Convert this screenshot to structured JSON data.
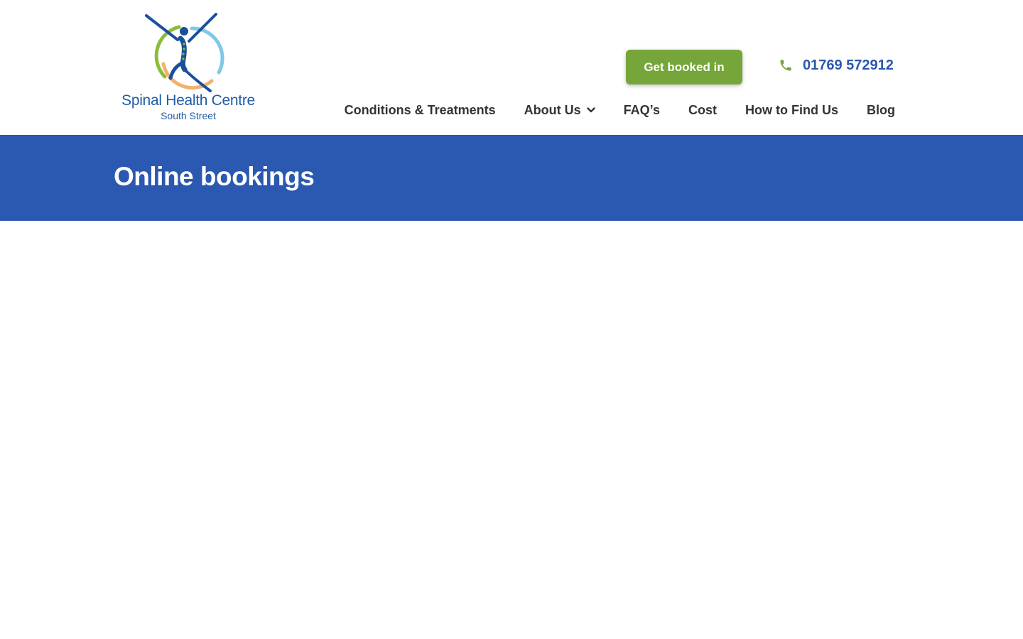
{
  "header": {
    "logo": {
      "name": "Spinal Health Centre",
      "subtitle": "South Street",
      "icon": "figure-with-circle-logo-icon"
    },
    "cta": {
      "label": "Get booked in"
    },
    "phone": {
      "icon": "phone-icon",
      "number": "01769 572912"
    },
    "nav": {
      "items": [
        {
          "label": "Conditions & Treatments"
        },
        {
          "label": "About Us",
          "icon": "chevron-down-icon"
        },
        {
          "label": "FAQ’s"
        },
        {
          "label": "Cost"
        },
        {
          "label": "How to Find Us"
        },
        {
          "label": "Blog"
        }
      ]
    }
  },
  "banner": {
    "title": "Online bookings"
  },
  "colors": {
    "brand_blue": "#2b58b0",
    "logo_blue": "#1f5ca8",
    "accent_green": "#76a53a",
    "nav_text": "#333333"
  }
}
